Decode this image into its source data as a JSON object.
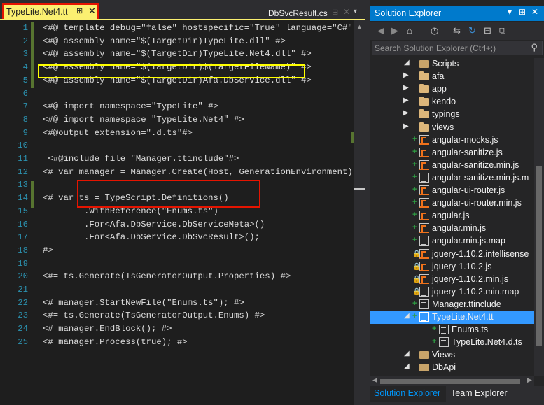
{
  "editor": {
    "active_tab": {
      "label": "TypeLite.Net4.tt",
      "pin": "⊞",
      "close": "✕"
    },
    "inactive_tab": {
      "label": "DbSvcResult.cs",
      "pin": "⊞",
      "close": "✕"
    },
    "dropdown_icon": "▾",
    "scroll_up_icon": "▲",
    "lines": [
      {
        "n": "1",
        "code": "<#@ template debug=\"false\" hostspecific=\"True\" language=\"C#\" #>"
      },
      {
        "n": "2",
        "code": "<#@ assembly name=\"$(TargetDir)TypeLite.dll\" #>"
      },
      {
        "n": "3",
        "code": "<#@ assembly name=\"$(TargetDir)TypeLite.Net4.dll\" #>"
      },
      {
        "n": "4",
        "code": "<#@ assembly name=\"$(TargetDir)$(TargetFileName)\" #>"
      },
      {
        "n": "5",
        "code": "<#@ assembly name=\"$(TargetDir)Afa.DbService.dll\" #>"
      },
      {
        "n": "6",
        "code": ""
      },
      {
        "n": "7",
        "code": "<#@ import namespace=\"TypeLite\" #>"
      },
      {
        "n": "8",
        "code": "<#@ import namespace=\"TypeLite.Net4\" #>"
      },
      {
        "n": "9",
        "code": "<#@output extension=\".d.ts\"#>"
      },
      {
        "n": "10",
        "code": ""
      },
      {
        "n": "11",
        "code": " <#@include file=\"Manager.ttinclude\"#>"
      },
      {
        "n": "12",
        "code": "<# var manager = Manager.Create(Host, GenerationEnvironment); #>"
      },
      {
        "n": "13",
        "code": ""
      },
      {
        "n": "14",
        "code": "<# var ts = TypeScript.Definitions()"
      },
      {
        "n": "15",
        "code": "        .WithReference(\"Enums.ts\")"
      },
      {
        "n": "16",
        "code": "        .For<Afa.DbService.DbServiceMeta>()"
      },
      {
        "n": "17",
        "code": "        .For<Afa.DbService.DbSvcResult>();"
      },
      {
        "n": "18",
        "code": "#>"
      },
      {
        "n": "19",
        "code": ""
      },
      {
        "n": "20",
        "code": "<#= ts.Generate(TsGeneratorOutput.Properties) #>"
      },
      {
        "n": "21",
        "code": ""
      },
      {
        "n": "22",
        "code": "<# manager.StartNewFile(\"Enums.ts\"); #>"
      },
      {
        "n": "23",
        "code": "<#= ts.Generate(TsGeneratorOutput.Enums) #>"
      },
      {
        "n": "24",
        "code": "<# manager.EndBlock(); #>"
      },
      {
        "n": "25",
        "code": "<# manager.Process(true); #>"
      }
    ]
  },
  "solution_explorer": {
    "title": "Solution Explorer",
    "title_icons": {
      "dropdown": "▾",
      "pin": "⊞",
      "close": "✕"
    },
    "toolbar_icons": {
      "back": "◀",
      "forward": "▶",
      "home": "⌂",
      "history": "◷",
      "sync": "⇆",
      "refresh": "↻",
      "collapse": "⊟",
      "show_all": "⧉"
    },
    "search": {
      "placeholder": "Search Solution Explorer (Ctrl+;)",
      "icon": "⚲"
    },
    "items": [
      {
        "label": "Scripts",
        "icon": "folder-open",
        "expander": "◢",
        "status": "",
        "indent": 0
      },
      {
        "label": "afa",
        "icon": "folder",
        "expander": "▶",
        "status": "",
        "indent": 1
      },
      {
        "label": "app",
        "icon": "folder",
        "expander": "▶",
        "status": "",
        "indent": 1
      },
      {
        "label": "kendo",
        "icon": "folder",
        "expander": "▶",
        "status": "",
        "indent": 1
      },
      {
        "label": "typings",
        "icon": "folder",
        "expander": "▶",
        "status": "",
        "indent": 1
      },
      {
        "label": "views",
        "icon": "folder",
        "expander": "▶",
        "status": "",
        "indent": 1
      },
      {
        "label": "angular-mocks.js",
        "icon": "js",
        "expander": "",
        "status": "+",
        "indent": 1
      },
      {
        "label": "angular-sanitize.js",
        "icon": "js",
        "expander": "",
        "status": "+",
        "indent": 1
      },
      {
        "label": "angular-sanitize.min.js",
        "icon": "js",
        "expander": "",
        "status": "+",
        "indent": 1
      },
      {
        "label": "angular-sanitize.min.js.m",
        "icon": "doc",
        "expander": "",
        "status": "+",
        "indent": 1
      },
      {
        "label": "angular-ui-router.js",
        "icon": "js",
        "expander": "",
        "status": "+",
        "indent": 1
      },
      {
        "label": "angular-ui-router.min.js",
        "icon": "js",
        "expander": "",
        "status": "+",
        "indent": 1
      },
      {
        "label": "angular.js",
        "icon": "js",
        "expander": "",
        "status": "+",
        "indent": 1
      },
      {
        "label": "angular.min.js",
        "icon": "js",
        "expander": "",
        "status": "+",
        "indent": 1
      },
      {
        "label": "angular.min.js.map",
        "icon": "doc",
        "expander": "",
        "status": "+",
        "indent": 1
      },
      {
        "label": "jquery-1.10.2.intellisense",
        "icon": "js",
        "expander": "",
        "status": "🔒",
        "indent": 1
      },
      {
        "label": "jquery-1.10.2.js",
        "icon": "js",
        "expander": "",
        "status": "🔒",
        "indent": 1
      },
      {
        "label": "jquery-1.10.2.min.js",
        "icon": "js",
        "expander": "",
        "status": "🔒",
        "indent": 1
      },
      {
        "label": "jquery-1.10.2.min.map",
        "icon": "doc",
        "expander": "",
        "status": "🔒",
        "indent": 1
      },
      {
        "label": "Manager.ttinclude",
        "icon": "doc",
        "expander": "",
        "status": "+",
        "indent": 1
      },
      {
        "label": "TypeLite.Net4.tt",
        "icon": "doc",
        "expander": "◢",
        "status": "+",
        "indent": 1,
        "selected": true
      },
      {
        "label": "Enums.ts",
        "icon": "ts",
        "expander": "",
        "status": "+",
        "indent": 2
      },
      {
        "label": "TypeLite.Net4.d.ts",
        "icon": "ts",
        "expander": "",
        "status": "+",
        "indent": 2
      },
      {
        "label": "Views",
        "icon": "folder-open",
        "expander": "◢",
        "status": "",
        "indent": 0
      },
      {
        "label": "DbApi",
        "icon": "folder-open",
        "expander": "◢",
        "status": "",
        "indent": 1
      }
    ],
    "scroll_icons": {
      "up": "▲",
      "left": "◀",
      "right": "▶"
    },
    "bottom_tabs": [
      {
        "label": "Solution Explorer",
        "active": true
      },
      {
        "label": "Team Explorer",
        "active": false
      }
    ]
  },
  "colors": {
    "accent": "#007acc",
    "active_tab_bg": "#fbf071",
    "highlight_yellow": "#ffff00",
    "highlight_red": "#e51400",
    "selection": "#3399ff",
    "line_number": "#2b91af"
  }
}
